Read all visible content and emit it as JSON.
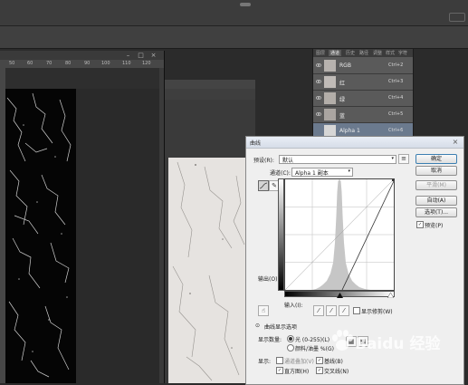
{
  "colors": {
    "app_bg": "#2b2b2b",
    "dialog_bg": "#efefef",
    "panel_bg": "#5a5a5a",
    "selected_channel": "#6b7a8e",
    "histogram": "#c6c6c6"
  },
  "doc1": {
    "ruler_ticks": [
      "50",
      "60",
      "70",
      "80",
      "90",
      "100",
      "110",
      "120"
    ]
  },
  "channels_panel": {
    "tabs": [
      "图层",
      "通道",
      "历史",
      "路径",
      "调整",
      "样式",
      "字符"
    ],
    "channels": [
      {
        "name": "RGB",
        "shortcut": "Ctrl+2",
        "thumb_color": "#b7b2ae"
      },
      {
        "name": "红",
        "shortcut": "Ctrl+3",
        "thumb_color": "#c0bbb7"
      },
      {
        "name": "绿",
        "shortcut": "Ctrl+4",
        "thumb_color": "#b3aea9"
      },
      {
        "name": "蓝",
        "shortcut": "Ctrl+5",
        "thumb_color": "#aaa5a1"
      },
      {
        "name": "Alpha 1",
        "shortcut": "Ctrl+6",
        "thumb_color": "#d6d6d6"
      }
    ]
  },
  "curves_dialog": {
    "title": "曲线",
    "preset_label": "预设(R):",
    "preset_value": "默认",
    "channel_label": "通道(C):",
    "channel_value": "Alpha 1 副本",
    "output_label": "输出(O):",
    "input_label": "输入(I):",
    "show_clipping_label": "显示修剪(W)",
    "curve_display_options_label": "曲线显示选项",
    "show_amount_label": "显示数量:",
    "light_option": "光 (0-255)(L)",
    "pigment_option": "颜料/油墨 %(G)",
    "show_label": "显示:",
    "channel_overlays": "通道叠加(V)",
    "baseline": "基线(B)",
    "histogram": "直方图(H)",
    "intersection_line": "交叉线(N)",
    "buttons": {
      "ok": "确定",
      "cancel": "取消",
      "smooth": "平滑(M)",
      "auto": "自动(A)",
      "options": "选项(T)...",
      "preview": "预览(P)"
    }
  },
  "watermark": {
    "text": "Baidu 经验"
  }
}
